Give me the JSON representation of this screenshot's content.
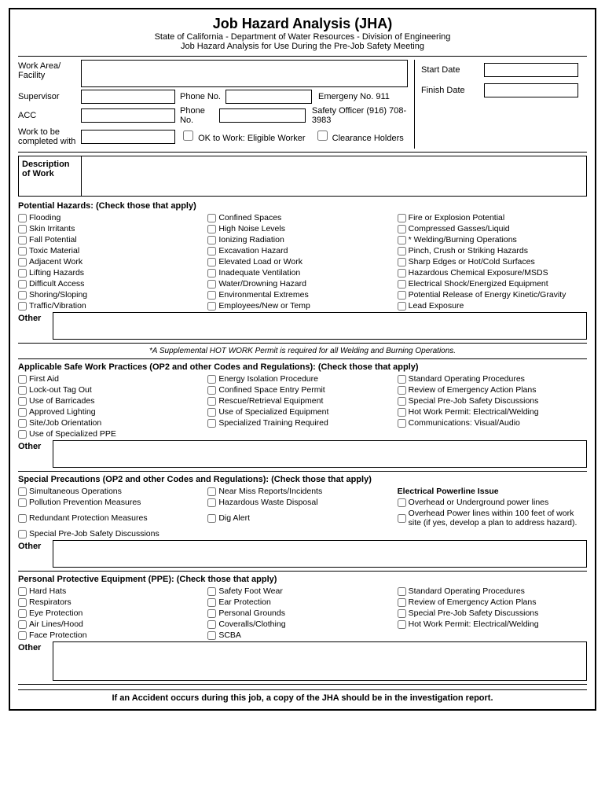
{
  "header": {
    "title": "Job Hazard Analysis (JHA)",
    "subtitle1": "State of California - Department of Water Resources - Division of Engineering",
    "subtitle2": "Job Hazard Analysis for Use During the Pre-Job Safety Meeting"
  },
  "form": {
    "work_area_label": "Work Area/\nFacility",
    "start_date_label": "Start Date",
    "finish_date_label": "Finish Date",
    "supervisor_label": "Supervisor",
    "phone_no_label": "Phone No.",
    "emergency_label": "Emergeny No. 911",
    "acc_label": "ACC",
    "safety_officer_label": "Safety Officer (916) 708-3983",
    "work_complete_label": "Work to be\ncompleted with",
    "ok_to_work_label": "OK to Work: Eligible Worker",
    "clearance_label": "Clearance Holders",
    "description_label": "Description\nof Work"
  },
  "potential_hazards": {
    "title": "Potential Hazards: (Check those that apply)",
    "col1": [
      "Flooding",
      "Skin Irritants",
      "Fall Potential",
      "Toxic Material",
      "Adjacent Work",
      "Lifting Hazards",
      "Difficult Access",
      "Shoring/Sloping",
      "Traffic/Vibration"
    ],
    "col2": [
      "Confined Spaces",
      "High Noise Levels",
      "Ionizing Radiation",
      "Excavation Hazard",
      "Elevated Load or Work",
      "Inadequate Ventilation",
      "Water/Drowning Hazard",
      "Environmental Extremes",
      "Employees/New or Temp"
    ],
    "col3": [
      "Fire or Explosion Potential",
      "Compressed Gasses/Liquid",
      "* Welding/Burning Operations",
      "Pinch, Crush or Striking Hazards",
      "Sharp Edges or Hot/Cold Surfaces",
      "Hazardous Chemical Exposure/MSDS",
      "Electrical Shock/Energized Equipment",
      "Potential Release of Energy Kinetic/Gravity",
      "Lead Exposure"
    ],
    "other_label": "Other"
  },
  "hot_work_note": "*A Supplemental HOT WORK Permit is required for all Welding and Burning Operations.",
  "safe_practices": {
    "title": "Applicable Safe Work Practices (OP2 and other Codes and Regulations): (Check those that apply)",
    "col1": [
      "First Aid",
      "Lock-out Tag Out",
      "Use of Barricades",
      "Approved Lighting",
      "Site/Job Orientation",
      "Use of Specialized PPE"
    ],
    "col2": [
      "Energy Isolation Procedure",
      "Confined Space Entry Permit",
      "Rescue/Retrieval Equipment",
      "Use of Specialized Equipment",
      "Specialized Training Required"
    ],
    "col3": [
      "Standard Operating Procedures",
      "Review of Emergency Action Plans",
      "Special Pre-Job Safety Discussions",
      "Hot Work Permit: Electrical/Welding",
      "Communications: Visual/Audio"
    ],
    "other_label": "Other"
  },
  "special_precautions": {
    "title": "Special Precautions (OP2 and other Codes and Regulations): (Check those that apply)",
    "col1": [
      "Simultaneous Operations",
      "Pollution Prevention Measures",
      "Redundant Protection Measures",
      "Special Pre-Job Safety Discussions"
    ],
    "col2": [
      "Near Miss Reports/Incidents",
      "Hazardous Waste Disposal",
      "Dig Alert"
    ],
    "col3_header": "Electrical Powerline Issue",
    "col3": [
      "Overhead or Underground power lines",
      "Overhead Power lines within 100 feet of work site (if yes, develop a plan to address hazard)."
    ],
    "other_label": "Other"
  },
  "ppe": {
    "title": "Personal Protective Equipment (PPE): (Check those that apply)",
    "col1": [
      "Hard Hats",
      "Respirators",
      "Eye Protection",
      "Air Lines/Hood",
      "Face Protection"
    ],
    "col2": [
      "Safety Foot Wear",
      "Ear Protection",
      "Personal Grounds",
      "Coveralls/Clothing",
      "SCBA"
    ],
    "col3": [
      "Standard Operating Procedures",
      "Review of Emergency Action Plans",
      "Special Pre-Job Safety Discussions",
      "Hot Work Permit: Electrical/Welding"
    ],
    "other_label": "Other"
  },
  "footer": {
    "note": "If an Accident occurs during this job, a copy of the JHA should be in the investigation report."
  }
}
